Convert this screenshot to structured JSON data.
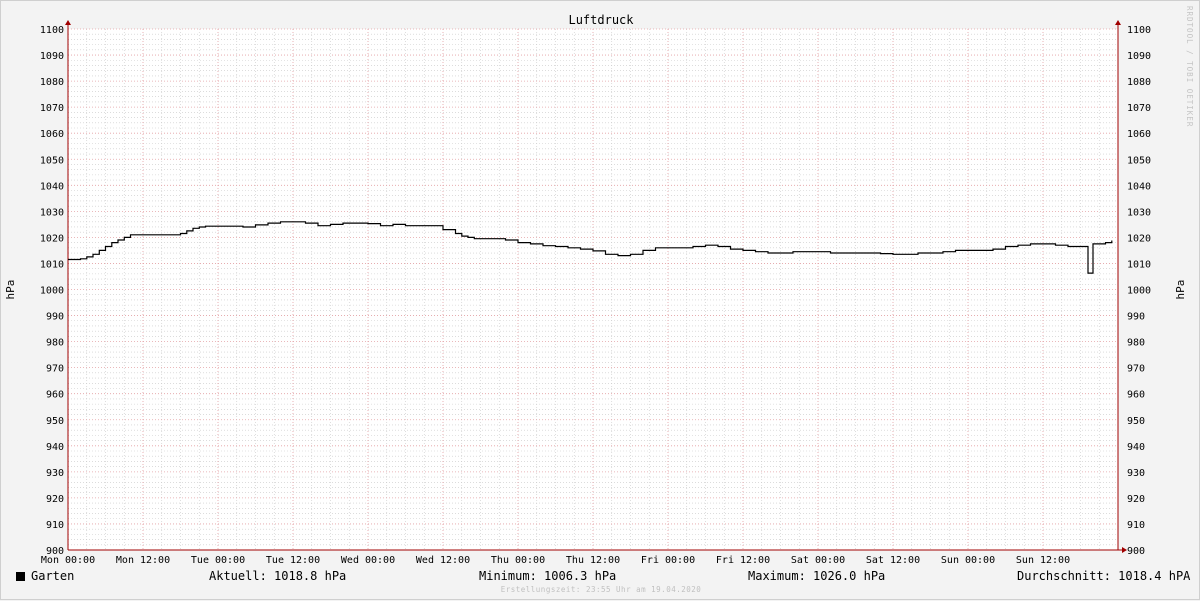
{
  "chart_data": {
    "type": "line",
    "title": "Luftdruck",
    "ylabel": "hPa",
    "ylim": [
      900,
      1100
    ],
    "yticks": [
      900,
      910,
      920,
      930,
      940,
      950,
      960,
      970,
      980,
      990,
      1000,
      1010,
      1020,
      1030,
      1040,
      1050,
      1060,
      1070,
      1080,
      1090,
      1100
    ],
    "xlim": [
      0,
      168
    ],
    "xticks": [
      {
        "t": 0,
        "label": "Mon 00:00"
      },
      {
        "t": 12,
        "label": "Mon 12:00"
      },
      {
        "t": 24,
        "label": "Tue 00:00"
      },
      {
        "t": 36,
        "label": "Tue 12:00"
      },
      {
        "t": 48,
        "label": "Wed 00:00"
      },
      {
        "t": 60,
        "label": "Wed 12:00"
      },
      {
        "t": 72,
        "label": "Thu 00:00"
      },
      {
        "t": 84,
        "label": "Thu 12:00"
      },
      {
        "t": 96,
        "label": "Fri 00:00"
      },
      {
        "t": 108,
        "label": "Fri 12:00"
      },
      {
        "t": 120,
        "label": "Sat 00:00"
      },
      {
        "t": 132,
        "label": "Sat 12:00"
      },
      {
        "t": 144,
        "label": "Sun 00:00"
      },
      {
        "t": 156,
        "label": "Sun 12:00"
      }
    ],
    "grid": true,
    "series": [
      {
        "name": "Garten",
        "color": "#000000",
        "x": [
          0,
          2,
          3,
          4,
          5,
          6,
          7,
          8,
          9,
          10,
          11,
          12,
          14,
          16,
          18,
          19,
          20,
          21,
          22,
          23,
          24,
          28,
          30,
          32,
          34,
          36,
          38,
          40,
          42,
          44,
          46,
          48,
          50,
          52,
          54,
          56,
          58,
          60,
          62,
          63,
          64,
          65,
          66,
          68,
          70,
          72,
          74,
          76,
          78,
          80,
          82,
          84,
          86,
          88,
          90,
          92,
          94,
          96,
          98,
          100,
          102,
          104,
          106,
          108,
          110,
          112,
          114,
          116,
          118,
          120,
          122,
          124,
          126,
          128,
          130,
          132,
          134,
          136,
          138,
          140,
          142,
          144,
          146,
          148,
          150,
          152,
          154,
          156,
          158,
          160,
          162,
          163,
          163.2,
          163.6,
          164,
          166,
          167
        ],
        "y": [
          1011.5,
          1011.8,
          1012.5,
          1013.5,
          1015,
          1016.5,
          1018,
          1019,
          1020,
          1021,
          1021,
          1021,
          1021,
          1021,
          1021.5,
          1022.5,
          1023.5,
          1024,
          1024.3,
          1024.3,
          1024.3,
          1024,
          1024.8,
          1025.5,
          1026,
          1026,
          1025.5,
          1024.5,
          1025,
          1025.5,
          1025.5,
          1025.3,
          1024.5,
          1025,
          1024.5,
          1024.5,
          1024.5,
          1023,
          1021.5,
          1020.5,
          1020,
          1019.5,
          1019.5,
          1019.5,
          1019,
          1018,
          1017.5,
          1016.8,
          1016.5,
          1016,
          1015.5,
          1014.8,
          1013.5,
          1013,
          1013.5,
          1015,
          1016,
          1016,
          1016,
          1016.5,
          1017,
          1016.5,
          1015.5,
          1015,
          1014.5,
          1014,
          1014,
          1014.5,
          1014.5,
          1014.5,
          1014,
          1014,
          1014,
          1014,
          1013.8,
          1013.5,
          1013.5,
          1014,
          1014,
          1014.5,
          1015,
          1015,
          1015,
          1015.5,
          1016.5,
          1017,
          1017.5,
          1017.5,
          1017,
          1016.5,
          1016.5,
          1016.5,
          1006.3,
          1006.3,
          1017.5,
          1018,
          1018.8
        ]
      }
    ]
  },
  "legend": {
    "series_label": "Garten",
    "current": "Aktuell: 1018.8 hPa",
    "minimum": "Minimum: 1006.3 hPa",
    "maximum": "Maximum: 1026.0 hPa",
    "average": "Durchschnitt: 1018.4 hPA"
  },
  "footer_text": "Erstellungszeit: 23:55 Uhr am 19.04.2020",
  "watermark_text": "RRDTOOL / TOBI OETIKER",
  "colors": {
    "background": "#f3f3f3",
    "plot_background": "#ffffff",
    "major_grid": "#e3a0a4",
    "minor_grid": "#c8c8c8",
    "axis": "#a00000",
    "line": "#000000"
  }
}
